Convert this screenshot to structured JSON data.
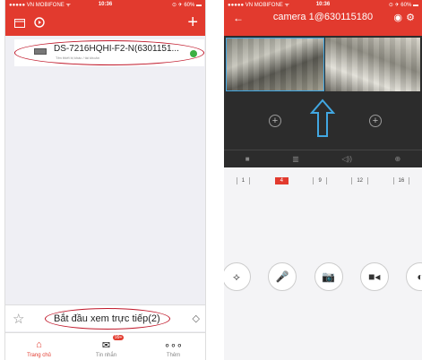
{
  "left": {
    "status": {
      "carrier": "●●●●● VN MOBIFONE ᯤ",
      "time": "10:36",
      "right": "⊙ ✈ 60% ▬"
    },
    "device": {
      "name": "DS-7216HQHI-F2-N(6301151...",
      "subtitle": "Tên thiết bị khác / tài khoản"
    },
    "live_button": "Bắt đầu xem trực tiếp(2)",
    "tabs": [
      {
        "label": "Trang chủ",
        "icon": "⌂"
      },
      {
        "label": "Tin nhắn",
        "icon": "✉",
        "badge": "99+"
      },
      {
        "label": "Thêm",
        "icon": "∘∘∘"
      }
    ]
  },
  "right": {
    "status": {
      "carrier": "●●●●● VN MOBIFONE ᯤ",
      "time": "10:36",
      "right": "⊙ ✈ 60% ▬"
    },
    "title": "camera 1@630115180",
    "controls": [
      "■",
      "▥",
      "◁))",
      "⊕"
    ],
    "splits": [
      "1",
      "4",
      "9",
      "12",
      "16"
    ],
    "active_split": "4",
    "tools": [
      "⟡",
      "🎤",
      "📷",
      "■◂",
      "◐"
    ]
  },
  "colors": {
    "accent": "#e23a2e",
    "annotation": "#c0182a",
    "selection": "#41a7e2",
    "online": "#3cb043"
  }
}
